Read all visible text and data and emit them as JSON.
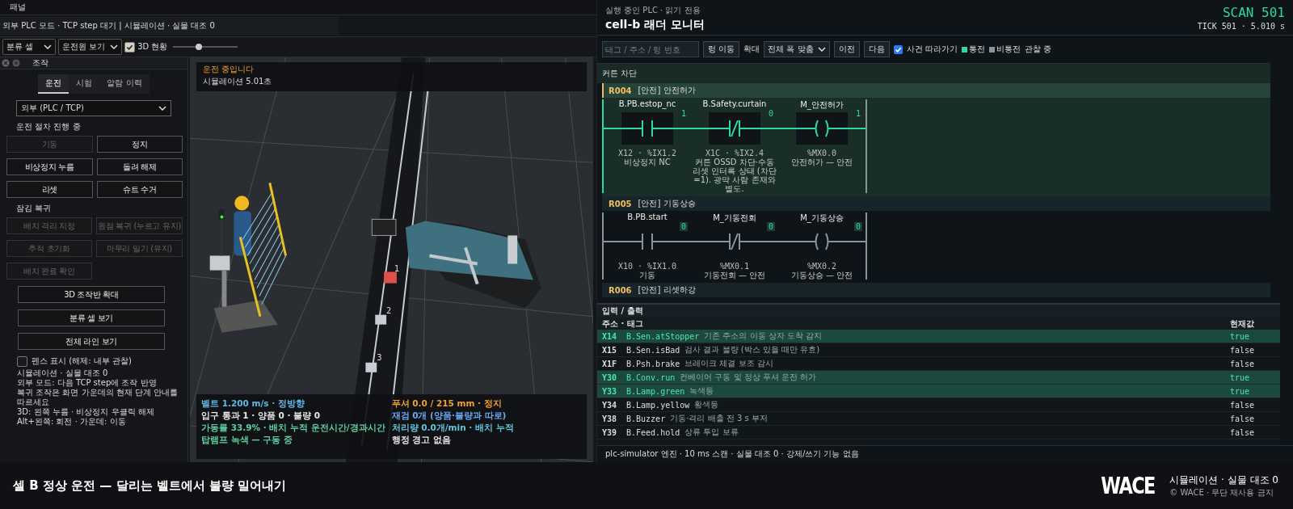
{
  "panel_header": {
    "title": "패널"
  },
  "mode_banner": "외부 PLC 모드 · TCP step 대기 | 시뮬레이션 · 실물 대조 0",
  "toolbar": {
    "cell_select": "분류 셀",
    "view_select": "운전원 보기",
    "show_3d": {
      "label": "3D 현황",
      "checked": true
    },
    "zoom_slider": {
      "level": 0.4
    }
  },
  "control_panel": {
    "title": "조작",
    "tabs": [
      {
        "label": "운전",
        "selected": true
      },
      {
        "label": "시험",
        "selected": false
      },
      {
        "label": "알람 이력",
        "selected": false
      }
    ],
    "source_select": "외부 (PLC / TCP)",
    "sections": [
      {
        "heading": "운전 절차 진행 중",
        "buttons": [
          {
            "label": "기동",
            "disabled": true
          },
          {
            "label": "정지",
            "disabled": false
          },
          {
            "label": "비상정지 누름",
            "disabled": false
          },
          {
            "label": "돌려 해제",
            "disabled": false
          },
          {
            "label": "리셋",
            "disabled": false
          },
          {
            "label": "슈트 수거",
            "disabled": false
          }
        ]
      },
      {
        "heading": "잠김 복귀",
        "buttons": [
          {
            "label": "배치 격리 지정",
            "disabled": true
          },
          {
            "label": "원점 복귀 (누르고 유지)",
            "disabled": true
          },
          {
            "label": "추적 초기화",
            "disabled": true
          },
          {
            "label": "마무리 밀기 (유지)",
            "disabled": true
          },
          {
            "label": "배치 완료 확인",
            "disabled": true
          }
        ]
      }
    ],
    "wide_buttons": [
      "3D 조작반 확대",
      "분류 셀 보기",
      "전체 라인 보기"
    ],
    "fence": {
      "label": "펜스 표시 (해제: 내부 관찰)",
      "checked": false
    },
    "notes": [
      "시뮬레이션 · 실물 대조 0",
      "외부 모드: 다음 TCP step에 조작 반영",
      "복귀 조작은 화면 가운데의 현재 단계 안내를 따르세요",
      "3D: 왼쪽 누름 · 비상정지 우클릭 해제",
      "Alt+왼쪽: 회전 · 가운데: 이동"
    ]
  },
  "viewport": {
    "status_title": "운전 중입니다",
    "sim_time": "시뮬레이션 5.01초",
    "box_labels": [
      "1",
      "2",
      "3"
    ],
    "stats_left": [
      {
        "text": "벨트 1.200 m/s · 정방향",
        "color": "#5fb8e6"
      },
      {
        "text": "입구 통과 1 · 양품 0 · 불량 0",
        "color": "#e6e6e6"
      },
      {
        "text": "가동률 33.9% · 배치 누적 운전시간/경과시간",
        "color": "#5ed0a0"
      },
      {
        "text": "탑램프 녹색 — 구동 중",
        "color": "#5ed0a0"
      }
    ],
    "stats_right": [
      {
        "text": "푸셔 0.0 / 215 mm · 정지",
        "color": "#f0a030"
      },
      {
        "text": "재검 0개 (양품·불량과 따로)",
        "color": "#6aa8f0"
      },
      {
        "text": "처리량 0.0개/min · 배치 누적",
        "color": "#5ec8d8"
      },
      {
        "text": "행정 경고 없음",
        "color": "#e6e6e6"
      }
    ]
  },
  "monitor": {
    "subtitle": "실행 중인 PLC · 읽기 전용",
    "title": "cell-b 래더 모니터",
    "scan": "SCAN 501",
    "tick": "TICK 501 · 5.010 s",
    "search_placeholder": "태그 / 주소 / 렁 번호",
    "goto_button": "렁 이동",
    "zoom_label": "확대",
    "zoom_select": "전체 폭 맞춤",
    "prev_button": "이전",
    "next_button": "다음",
    "follow": {
      "label": "사건 따라가기",
      "checked": true
    },
    "legend": [
      {
        "label": "통전",
        "color": "#2ed8a0"
      },
      {
        "label": "비통전",
        "color": "#8a949c"
      }
    ],
    "observe": "관찰 중",
    "group": "커튼 차단",
    "rungs": [
      {
        "id": "R004",
        "title": "[안전] 안전허가",
        "active": true,
        "elements": [
          {
            "kind": "no",
            "tag": "B.PB.estop_nc",
            "value": "1",
            "energized": true,
            "address": "X12 · %IX1.2",
            "note": "비상정지 NC"
          },
          {
            "kind": "nc",
            "tag": "B.Safety.curtain",
            "value": "0",
            "energized": true,
            "address": "X1C · %IX2.4",
            "note": "커튼 OSSD 차단·수동 리셋 인터록 상태 (차단=1). 광막 사람 존재와 별도."
          },
          {
            "kind": "coil",
            "tag": "M_안전허가",
            "value": "1",
            "energized": true,
            "address": "%MX0.0",
            "note": "안전허가 — 안전"
          }
        ]
      },
      {
        "id": "R005",
        "title": "[안전] 기동상승",
        "active": false,
        "elements": [
          {
            "kind": "no",
            "tag": "B.PB.start",
            "value": "0",
            "energized": false,
            "address": "X10 · %IX1.0",
            "note": "기동"
          },
          {
            "kind": "nc",
            "tag": "M_기동전회",
            "value": "0",
            "energized": false,
            "address": "%MX0.1",
            "note": "기동전회 — 안전"
          },
          {
            "kind": "coil",
            "tag": "M_기동상승",
            "value": "0",
            "energized": false,
            "address": "%MX0.2",
            "note": "기동상승 — 안전"
          }
        ]
      },
      {
        "id": "R006",
        "title": "[안전] 리셋하강",
        "active": false
      }
    ],
    "io": {
      "title": "입력 / 출력",
      "columns": [
        "주소 · 태그",
        "현재값"
      ],
      "rows": [
        {
          "address": "X14",
          "tag": "B.Sen.atStopper",
          "description": "기존 주소의 이동 상자 도착 감지",
          "value": "true",
          "on": true
        },
        {
          "address": "X15",
          "tag": "B.Sen.isBad",
          "description": "검사 결과 불량 (박스 있을 때만 유효)",
          "value": "false",
          "on": false
        },
        {
          "address": "X1F",
          "tag": "B.Psh.brake",
          "description": "브레이크 체결 보조 감시",
          "value": "false",
          "on": false
        },
        {
          "address": "Y30",
          "tag": "B.Conv.run",
          "description": "컨베이어 구동 및 정상 푸셔 운전 허가",
          "value": "true",
          "on": true
        },
        {
          "address": "Y33",
          "tag": "B.Lamp.green",
          "description": "녹색등",
          "value": "true",
          "on": true
        },
        {
          "address": "Y34",
          "tag": "B.Lamp.yellow",
          "description": "황색등",
          "value": "false",
          "on": false
        },
        {
          "address": "Y38",
          "tag": "B.Buzzer",
          "description": "기동·격리 배출 전 3 s 부저",
          "value": "false",
          "on": false
        },
        {
          "address": "Y39",
          "tag": "B.Feed.hold",
          "description": "상류 투입 보류",
          "value": "false",
          "on": false
        }
      ]
    },
    "footer": "plc-simulator 엔진 · 10 ms 스캔 · 실물 대조 0 · 강제/쓰기 기능 없음"
  },
  "caption": {
    "text": "셀 B 정상 운전 — 달리는 벨트에서 불량 밀어내기",
    "logo": "WACE",
    "title": "시뮬레이션 · 실물 대조 0",
    "copyright": "© WACE · 무단 재사용 금지"
  }
}
